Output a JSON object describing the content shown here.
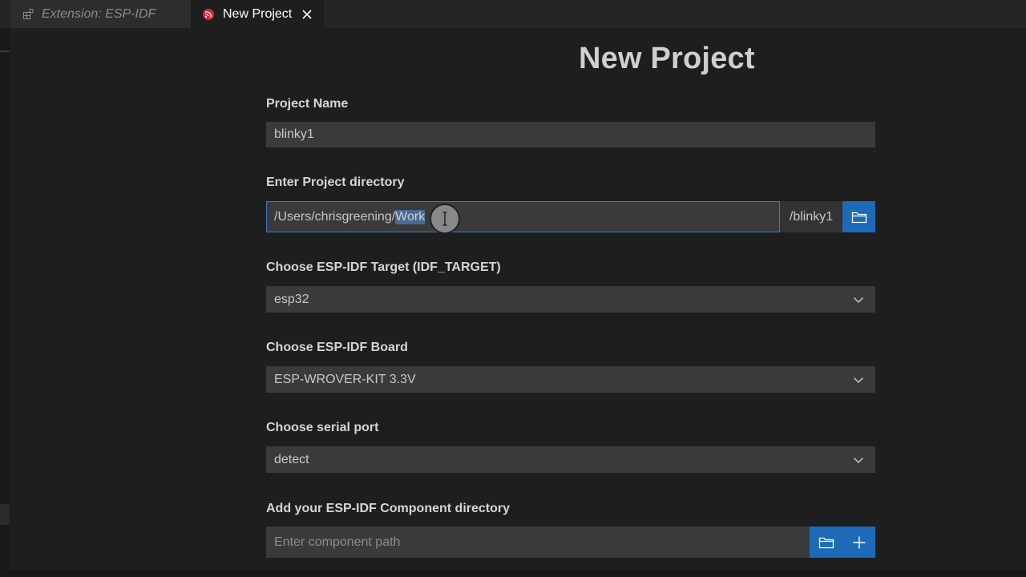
{
  "tabs": [
    {
      "label": "Extension: ESP-IDF",
      "icon": "extension-icon"
    },
    {
      "label": "New Project",
      "icon": "espressif-logo-icon",
      "active": true
    }
  ],
  "page": {
    "title": "New Project"
  },
  "form": {
    "project_name": {
      "label": "Project Name",
      "value": "blinky1"
    },
    "project_directory": {
      "label": "Enter Project directory",
      "value_prefix": "/Users/chrisgreening/",
      "value_selected": "Work",
      "suffix": "/blinky1"
    },
    "target": {
      "label": "Choose ESP-IDF Target (IDF_TARGET)",
      "value": "esp32"
    },
    "board": {
      "label": "Choose ESP-IDF Board",
      "value": "ESP-WROVER-KIT 3.3V"
    },
    "serial_port": {
      "label": "Choose serial port",
      "value": "detect"
    },
    "component_directory": {
      "label": "Add your ESP-IDF Component directory",
      "placeholder": "Enter component path"
    }
  },
  "colors": {
    "accent": "#1d6ab8",
    "focus_border": "#3e7ac7",
    "background": "#1e1e1e",
    "input_bg": "#3a3a3a"
  }
}
